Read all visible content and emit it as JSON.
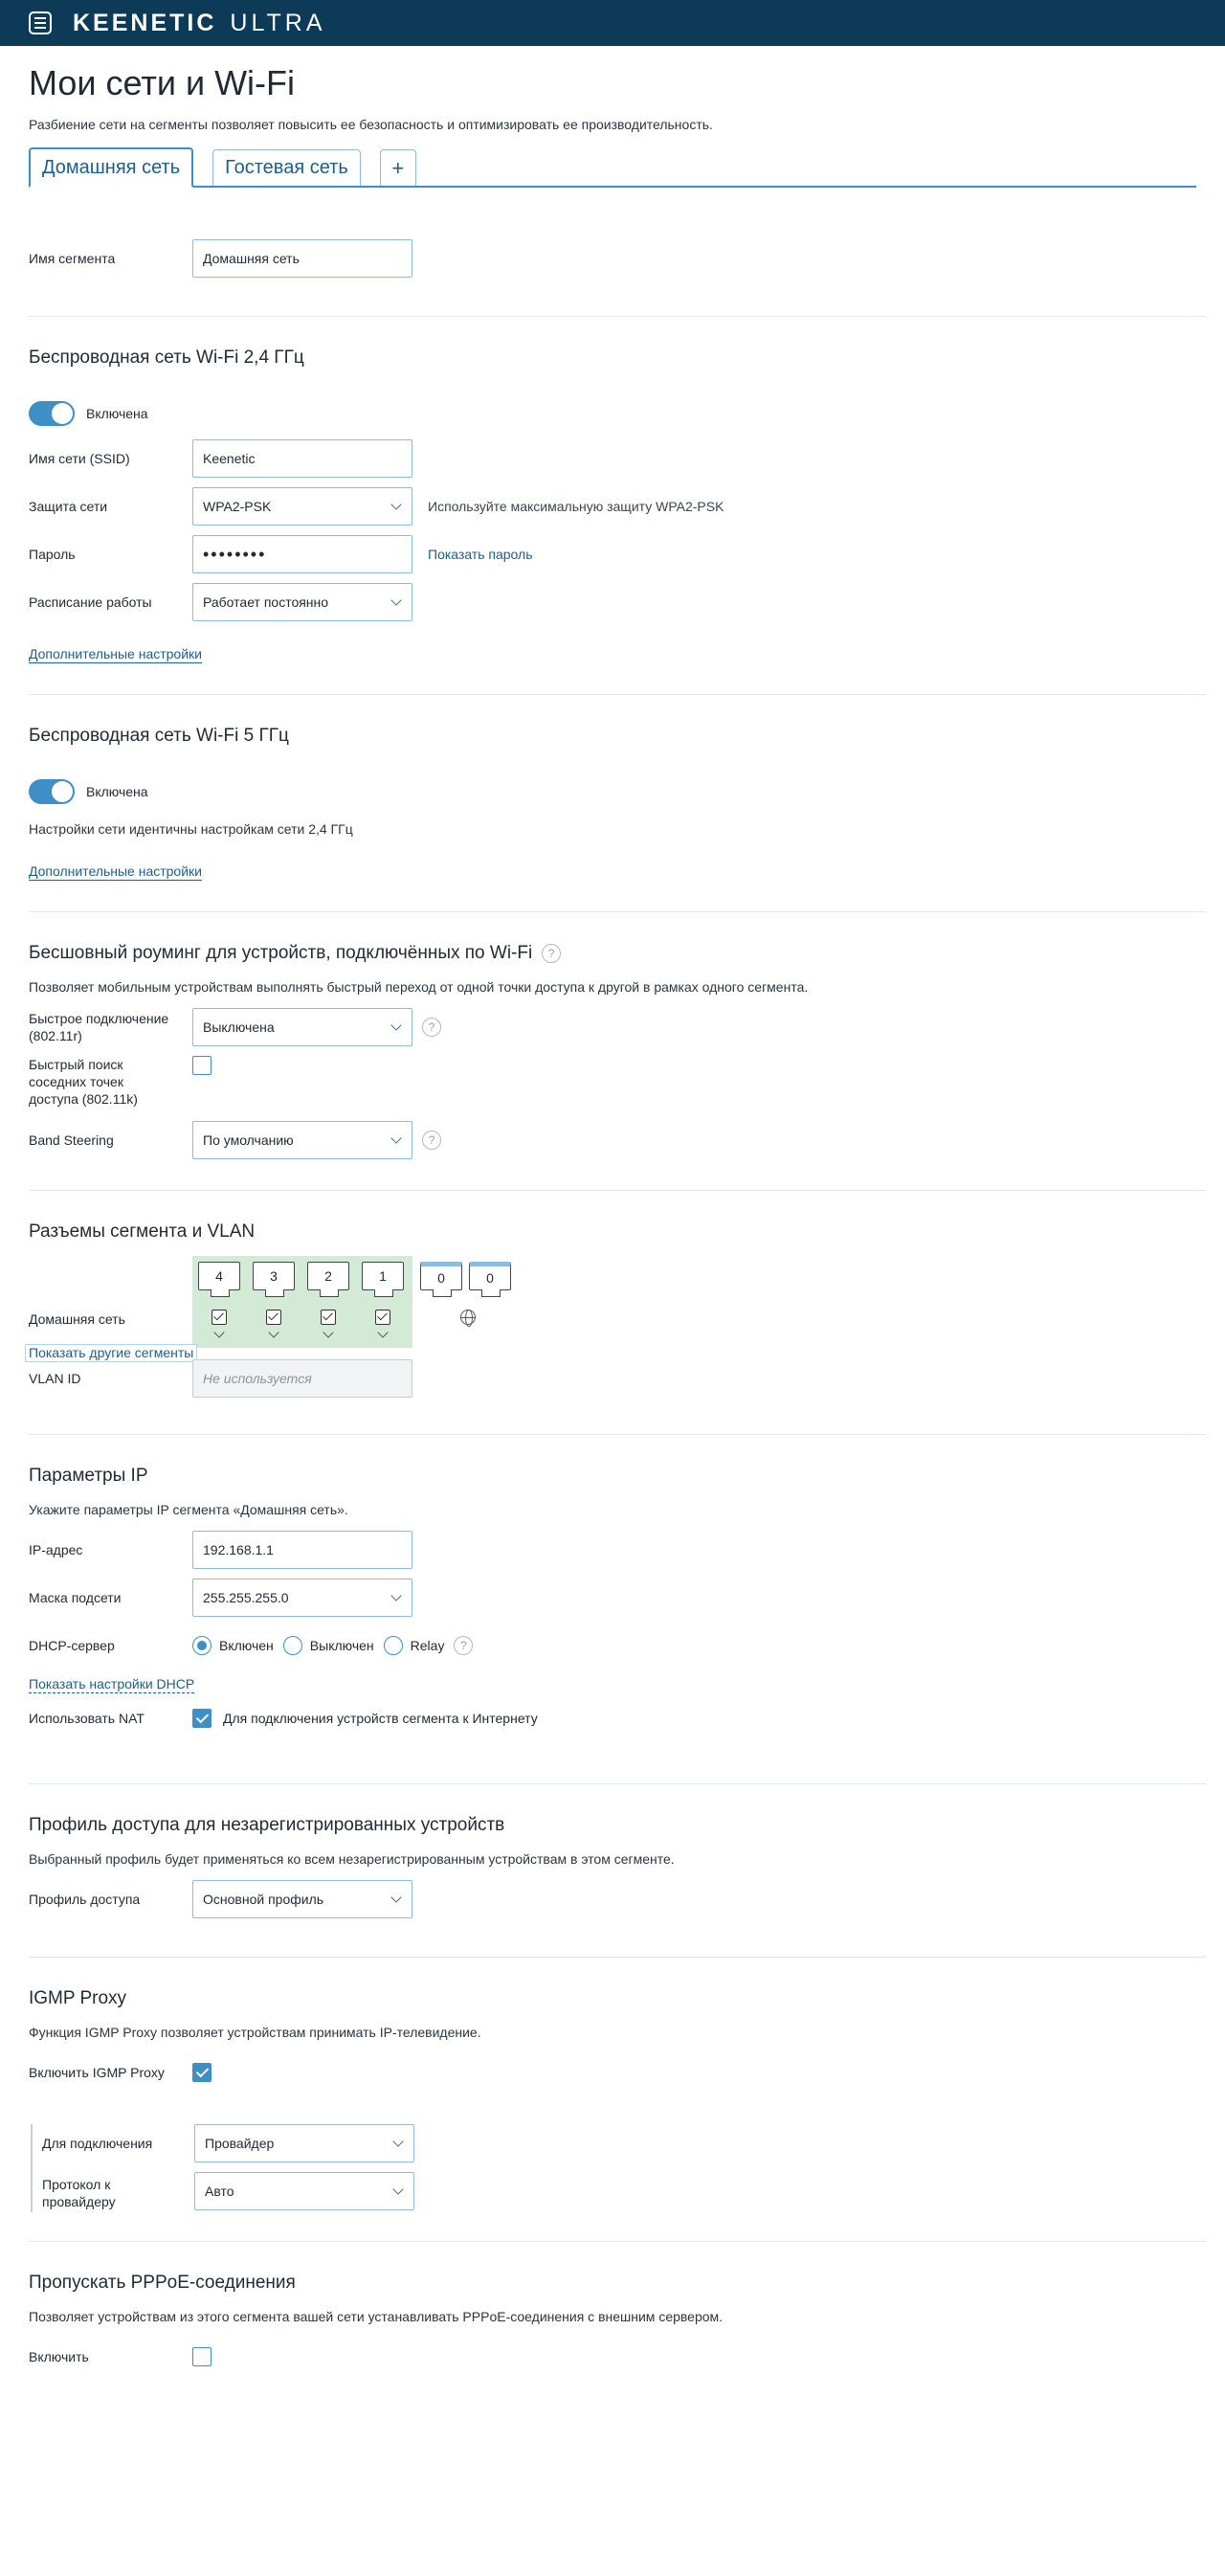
{
  "header": {
    "brand": "KEENETIC",
    "model": "ULTRA"
  },
  "page": {
    "title": "Мои сети и Wi-Fi",
    "subtitle": "Разбиение сети на сегменты позволяет повысить ее безопасность и оптимизировать ее производительность."
  },
  "tabs": [
    {
      "label": "Домашняя сеть"
    },
    {
      "label": "Гостевая сеть"
    },
    {
      "label": "+"
    }
  ],
  "segment": {
    "label": "Имя сегмента",
    "value": "Домашняя сеть"
  },
  "wifi24": {
    "title": "Беспроводная сеть Wi-Fi 2,4 ГГц",
    "toggle_label": "Включена",
    "ssid_label": "Имя сети (SSID)",
    "ssid_value": "Keenetic",
    "security_label": "Защита сети",
    "security_value": "WPA2-PSK",
    "security_hint": "Используйте максимальную защиту WPA2-PSK",
    "password_label": "Пароль",
    "password_value": "••••••••",
    "show_password": "Показать пароль",
    "schedule_label": "Расписание работы",
    "schedule_value": "Работает постоянно",
    "advanced": "Дополнительные настройки"
  },
  "wifi5": {
    "title": "Беспроводная сеть Wi-Fi 5 ГГц",
    "toggle_label": "Включена",
    "note": "Настройки сети идентичны настройкам сети 2,4 ГГц",
    "advanced": "Дополнительные настройки"
  },
  "roaming": {
    "title": "Бесшовный роуминг для устройств, подключённых по Wi-Fi",
    "desc": "Позволяет мобильным устройствам выполнять быстрый переход от одной точки доступа к другой в рамках одного сегмента.",
    "fast_label": "Быстрое подключение (802.11r)",
    "fast_value": "Выключена",
    "neighbors_label": "Быстрый поиск соседних точек доступа (802.11k)",
    "band_label": "Band Steering",
    "band_value": "По умолчанию",
    "help": "?"
  },
  "ports": {
    "title": "Разъемы сегмента и VLAN",
    "row_label": "Домашняя сеть",
    "lan_ports": [
      "4",
      "3",
      "2",
      "1"
    ],
    "extra_ports": [
      "0",
      "0"
    ],
    "show_other": "Показать другие сегменты",
    "vlan_label": "VLAN ID",
    "vlan_placeholder": "Не используется"
  },
  "ip": {
    "title": "Параметры IP",
    "desc": "Укажите параметры IP сегмента «Домашняя сеть».",
    "addr_label": "IP-адрес",
    "addr_value": "192.168.1.1",
    "mask_label": "Маска подсети",
    "mask_value": "255.255.255.0",
    "dhcp_label": "DHCP-сервер",
    "dhcp_options": [
      "Включен",
      "Выключен",
      "Relay"
    ],
    "show_dhcp": "Показать настройки DHCP",
    "nat_label": "Использовать NAT",
    "nat_text": "Для подключения устройств сегмента к Интернету"
  },
  "profile": {
    "title": "Профиль доступа для незарегистрированных устройств",
    "desc": "Выбранный профиль будет применяться ко всем незарегистрированным устройствам в этом сегменте.",
    "label": "Профиль доступа",
    "value": "Основной профиль"
  },
  "igmp": {
    "title": "IGMP Proxy",
    "desc": "Функция IGMP Proxy позволяет устройствам принимать IP-телевидение.",
    "enable_label": "Включить IGMP Proxy",
    "conn_label": "Для подключения",
    "conn_value": "Провайдер",
    "proto_label": "Протокол к провайдеру",
    "proto_value": "Авто"
  },
  "pppoe": {
    "title": "Пропускать PPPoE-соединения",
    "desc": "Позволяет устройствам из этого сегмента вашей сети устанавливать PPPoE-соединения с внешним сервером.",
    "enable_label": "Включить"
  },
  "colors": {
    "header_bg": "#0c3a57",
    "accent": "#3d8fc6",
    "link": "#1c5f8e",
    "ports_bg": "#d3ebd6"
  }
}
